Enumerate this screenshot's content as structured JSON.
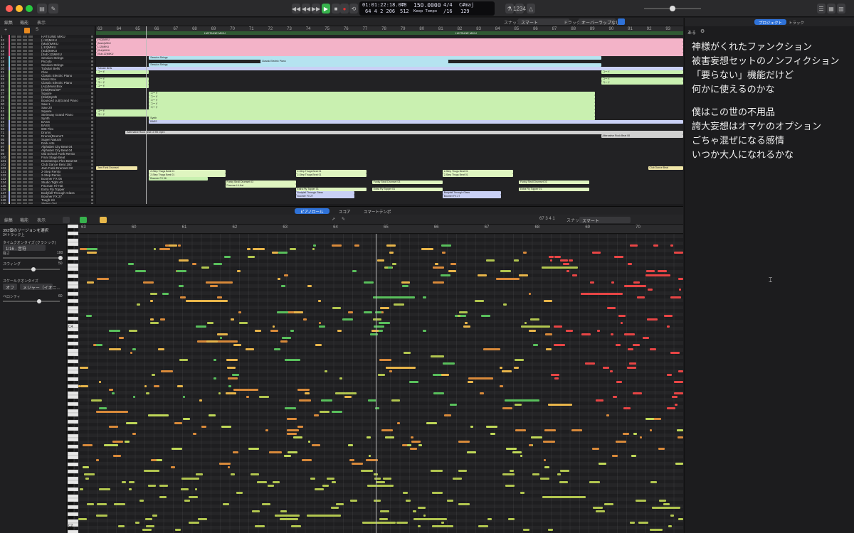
{
  "transport": {
    "position_time": "01:01:22:18.07",
    "position_bars": "64  4  2  206",
    "bars_value": "48",
    "bars_sub": "512",
    "tempo": "150.0000",
    "tempo_mode": "Keep Tempo",
    "signature": "4/4",
    "division": "/16",
    "key": "C#maj",
    "cpu": "129"
  },
  "arrange_toolbar": {
    "edit": "編集",
    "functions": "機能",
    "view": "表示",
    "snap_label": "スナップ:",
    "snap_value": "スマート",
    "drag_label": "ドラッグ:",
    "drag_value": "オーバーラップなし"
  },
  "side_panel": {
    "tab_project": "プロジェクト",
    "tab_track": "トラック",
    "sub_header": "ある"
  },
  "marker_labels": [
    "HATSUNE MIKU",
    "HATSUNE MIKU"
  ],
  "tracks": [
    {
      "num": "1",
      "name": "HATSUNE MIKU",
      "color": "#e75a8a"
    },
    {
      "num": "12",
      "name": "(+12)MIKU",
      "color": "#e75a8a"
    },
    {
      "num": "13",
      "name": "(Main)MIKU",
      "color": "#e75a8a"
    },
    {
      "num": "14",
      "name": "(-12)MIKU",
      "color": "#e75a8a"
    },
    {
      "num": "15",
      "name": "(Sub)MIKU",
      "color": "#e75a8a"
    },
    {
      "num": "16",
      "name": "(Sub-12)MIKU",
      "color": "#e75a8a"
    },
    {
      "num": "17",
      "name": "Session Strings",
      "color": "#7fd0e8"
    },
    {
      "num": "18",
      "name": "Piccolo",
      "color": "#7fd0e8"
    },
    {
      "num": "19",
      "name": "Session Strings",
      "color": "#7fd0e8"
    },
    {
      "num": "20",
      "name": "Tubular Bells",
      "color": "#a9b6f0"
    },
    {
      "num": "21",
      "name": "Clav",
      "color": "#9fd87f"
    },
    {
      "num": "22",
      "name": "Classic Electric Piano",
      "color": "#9fd87f"
    },
    {
      "num": "23",
      "name": "Music Box",
      "color": "#9fd87f"
    },
    {
      "num": "24",
      "name": "Classic Electric Piano",
      "color": "#9fd87f"
    },
    {
      "num": "25",
      "name": "(Arp)MusicBox",
      "color": "#9fd87f"
    },
    {
      "num": "26",
      "name": "(Dist)Real EP",
      "color": "#9fd87f"
    },
    {
      "num": "27",
      "name": "Square",
      "color": "#9fd87f"
    },
    {
      "num": "28",
      "name": "(Dist)Synth",
      "color": "#9fd87f"
    },
    {
      "num": "29",
      "name": "Bounced cut(Grand Piano",
      "color": "#9fd87f"
    },
    {
      "num": "30",
      "name": "Saw 1",
      "color": "#9fd87f"
    },
    {
      "num": "41",
      "name": "Saw 20",
      "color": "#9fd87f"
    },
    {
      "num": "42",
      "name": "Square",
      "color": "#9fd87f"
    },
    {
      "num": "45",
      "name": "Steinway Grand Piano",
      "color": "#9fd87f"
    },
    {
      "num": "46",
      "name": "Synth",
      "color": "#9fd87f"
    },
    {
      "num": "49",
      "name": "BASS",
      "color": "#a9b6f0"
    },
    {
      "num": "52",
      "name": "BASS",
      "color": "#a9b6f0"
    },
    {
      "num": "53",
      "name": "808 Flex",
      "color": "#a9b6f0"
    },
    {
      "num": "71",
      "name": "Drums",
      "color": "#c9c9c9"
    },
    {
      "num": "72",
      "name": "Drums(DrumsT.",
      "color": "#c9c9c9"
    },
    {
      "num": "95",
      "name": "Super Natural",
      "color": "#c9c9c9"
    },
    {
      "num": "96",
      "name": "Dark Arts",
      "color": "#c9c9c9"
    },
    {
      "num": "97",
      "name": "Alphabet City Beat 04",
      "color": "#e9d98f"
    },
    {
      "num": "98",
      "name": "Alphabet City Beat 04",
      "color": "#e9d98f"
    },
    {
      "num": "99",
      "name": "Old School Funk Remix",
      "color": "#e9d98f"
    },
    {
      "num": "100",
      "name": "Final Stage Beat",
      "color": "#e9d98f"
    },
    {
      "num": "101",
      "name": "Downtempo Flex Beat 02",
      "color": "#e9d98f"
    },
    {
      "num": "102",
      "name": "Club Dance Beat 192",
      "color": "#e9d98f"
    },
    {
      "num": "103",
      "name": "Jam Funk Drumset 02",
      "color": "#e9d98f"
    },
    {
      "num": "121",
      "name": "2-Step Remix",
      "color": "#c9f0a0"
    },
    {
      "num": "122",
      "name": "2-Step Remix",
      "color": "#c9f0a0"
    },
    {
      "num": "123",
      "name": "Boomer FX 06",
      "color": "#c9f0a0"
    },
    {
      "num": "124",
      "name": "Studio Tight 40",
      "color": "#c9f0a0"
    },
    {
      "num": "125",
      "name": "Pacman Hi-Hat",
      "color": "#c9f0a0"
    },
    {
      "num": "126",
      "name": "Extra Fly Topper",
      "color": "#c9f0a0"
    },
    {
      "num": "127",
      "name": "Bodyfall Through Glass",
      "color": "#a9b6f0"
    },
    {
      "num": "128",
      "name": "Boomer FX 27",
      "color": "#a9b6f0"
    },
    {
      "num": "129",
      "name": "Tough Kit",
      "color": "#a9b6f0"
    },
    {
      "num": "130",
      "name": "Stereo Out",
      "color": "#c9c9c9"
    }
  ],
  "arrange_bars": [
    "63",
    "64",
    "65",
    "66",
    "67",
    "68",
    "69",
    "70",
    "71",
    "72",
    "73",
    "74",
    "75",
    "76",
    "77",
    "78",
    "79",
    "80",
    "81",
    "82",
    "83",
    "84",
    "85",
    "86",
    "87",
    "88",
    "89",
    "90",
    "91",
    "92",
    "93"
  ],
  "regions": [
    {
      "row": 1,
      "start": 0.0,
      "end": 1.0,
      "color": "#f3b3c8",
      "label": "(+12)MIKU"
    },
    {
      "row": 2,
      "start": 0.0,
      "end": 1.0,
      "color": "#f3b3c8",
      "label": "(Main)MIKU"
    },
    {
      "row": 3,
      "start": 0.0,
      "end": 1.0,
      "color": "#f3b3c8",
      "label": "(-12)MIKU"
    },
    {
      "row": 4,
      "start": 0.0,
      "end": 1.0,
      "color": "#f3b3c8",
      "label": "(Sub)MIKU"
    },
    {
      "row": 5,
      "start": 0.0,
      "end": 1.0,
      "color": "#f3b3c8",
      "label": "(Sub-12)MIKU"
    },
    {
      "row": 6,
      "start": 0.09,
      "end": 0.86,
      "color": "#b5e3f0",
      "label": "Session Strings"
    },
    {
      "row": 7,
      "start": 0.28,
      "end": 0.6,
      "color": "#b5e3f0",
      "label": "Classic Electric Piano"
    },
    {
      "row": 8,
      "start": 0.09,
      "end": 0.86,
      "color": "#b5e3f0",
      "label": "Session Strings"
    },
    {
      "row": 9,
      "start": 0.0,
      "end": 1.0,
      "color": "#c9d0f5",
      "label": "Tubular Bells"
    },
    {
      "row": 10,
      "start": 0.0,
      "end": 0.09,
      "color": "#c9f0b0",
      "label": "コード"
    },
    {
      "row": 10,
      "start": 0.86,
      "end": 1.0,
      "color": "#c9f0b0",
      "label": "コード"
    },
    {
      "row": 12,
      "start": 0.0,
      "end": 0.09,
      "color": "#c9f0b0",
      "label": "コード"
    },
    {
      "row": 12,
      "start": 0.86,
      "end": 1.0,
      "color": "#c9f0b0",
      "label": "コード"
    },
    {
      "row": 13,
      "start": 0.0,
      "end": 0.09,
      "color": "#c9f0b0",
      "label": "コード"
    },
    {
      "row": 13,
      "start": 0.86,
      "end": 1.0,
      "color": "#c9f0b0",
      "label": "コード"
    },
    {
      "row": 14,
      "start": 0.0,
      "end": 0.09,
      "color": "#c9f0b0",
      "label": "コード"
    },
    {
      "row": 16,
      "start": 0.09,
      "end": 0.85,
      "color": "#c9f0b0",
      "label": "コード"
    },
    {
      "row": 17,
      "start": 0.09,
      "end": 0.85,
      "color": "#c9f0b0",
      "label": "コード"
    },
    {
      "row": 18,
      "start": 0.09,
      "end": 0.85,
      "color": "#c9f0b0",
      "label": "コード"
    },
    {
      "row": 19,
      "start": 0.09,
      "end": 0.85,
      "color": "#c9f0b0",
      "label": "コード"
    },
    {
      "row": 20,
      "start": 0.09,
      "end": 0.85,
      "color": "#c9f0b0",
      "label": "コード"
    },
    {
      "row": 21,
      "start": 0.0,
      "end": 0.85,
      "color": "#c9f0b0",
      "label": "コード"
    },
    {
      "row": 22,
      "start": 0.0,
      "end": 0.85,
      "color": "#c9f0b0",
      "label": "コード"
    },
    {
      "row": 23,
      "start": 0.09,
      "end": 0.85,
      "color": "#c9f0b0",
      "label": "Synth"
    },
    {
      "row": 24,
      "start": 0.09,
      "end": 1.0,
      "color": "#c9d0f5",
      "label": "BASS"
    },
    {
      "row": 27,
      "start": 0.05,
      "end": 1.0,
      "color": "#d0d0d0",
      "label": "Alternative Rock Beat 10 Hit Open"
    },
    {
      "row": 28,
      "start": 0.86,
      "end": 1.0,
      "color": "#d0d0d0",
      "label": "Alternative Rock Beat 08"
    },
    {
      "row": 37,
      "start": 0.0,
      "end": 0.07,
      "color": "#f0e6a8",
      "label": "Jam Funk Drumset"
    },
    {
      "row": 37,
      "start": 0.94,
      "end": 1.0,
      "color": "#f0e6a8",
      "label": "Club Dance Beat"
    },
    {
      "row": 38,
      "start": 0.09,
      "end": 0.22,
      "color": "#dff5c0",
      "label": "2-Step Thugs Beat 01"
    },
    {
      "row": 38,
      "start": 0.34,
      "end": 0.46,
      "color": "#dff5c0",
      "label": "2-Step Thugs Beat 01"
    },
    {
      "row": 38,
      "start": 0.59,
      "end": 0.71,
      "color": "#dff5c0",
      "label": "2-Step Thugs Beat 01"
    },
    {
      "row": 39,
      "start": 0.09,
      "end": 0.22,
      "color": "#dff5c0",
      "label": "2-Step Thugs Beat 01"
    },
    {
      "row": 39,
      "start": 0.34,
      "end": 0.46,
      "color": "#dff5c0",
      "label": "2-Step Thugs Beat 01"
    },
    {
      "row": 39,
      "start": 0.59,
      "end": 0.71,
      "color": "#dff5c0",
      "label": "2-Step Thugs Beat 01"
    },
    {
      "row": 40,
      "start": 0.09,
      "end": 0.19,
      "color": "#c9f0b0",
      "label": "Boomer FX 06"
    },
    {
      "row": 41,
      "start": 0.22,
      "end": 0.34,
      "color": "#dff5c0",
      "label": "Funky Stroll Drumset 03"
    },
    {
      "row": 41,
      "start": 0.47,
      "end": 0.59,
      "color": "#dff5c0",
      "label": "Funky Stroll Drumset 03"
    },
    {
      "row": 41,
      "start": 0.72,
      "end": 0.84,
      "color": "#dff5c0",
      "label": "Funky Stroll Drumset 03"
    },
    {
      "row": 42,
      "start": 0.22,
      "end": 0.34,
      "color": "#dff5c0",
      "label": "Pacman Hi-Hat"
    },
    {
      "row": 43,
      "start": 0.34,
      "end": 0.46,
      "color": "#dff5c0",
      "label": "Extra Fly Topper 01"
    },
    {
      "row": 43,
      "start": 0.47,
      "end": 0.59,
      "color": "#dff5c0",
      "label": "Extra Fly Topper 01"
    },
    {
      "row": 43,
      "start": 0.72,
      "end": 0.84,
      "color": "#dff5c0",
      "label": "Extra Fly Topper 01"
    },
    {
      "row": 44,
      "start": 0.34,
      "end": 0.44,
      "color": "#c9d0f5",
      "label": "Bodyfall Through Glass"
    },
    {
      "row": 44,
      "start": 0.59,
      "end": 0.69,
      "color": "#c9d0f5",
      "label": "Bodyfall Through Glass"
    },
    {
      "row": 45,
      "start": 0.34,
      "end": 0.44,
      "color": "#c9d0f5",
      "label": "Boomer FX 27"
    },
    {
      "row": 45,
      "start": 0.59,
      "end": 0.69,
      "color": "#c9d0f5",
      "label": "Boomer FX 27"
    }
  ],
  "lyrics": {
    "stanza1": [
      "神様がくれたファンクション",
      "被害妄想セットのノンフィクション",
      "「要らない」機能だけど",
      "何かに使えるのかな"
    ],
    "stanza2": [
      "僕はこの世の不用品",
      "誇大妄想はオマケのオプション",
      "ごちゃ混ぜになる感情",
      "いつか大人になれるかな"
    ]
  },
  "piano_roll": {
    "tab_piano_roll": "ピアノロール",
    "tab_score": "スコア",
    "tab_smart_tempo": "スマートテンポ",
    "edit": "編集",
    "functions": "機能",
    "view": "表示",
    "position": "67 3 4 1",
    "snap_label": "スナップ:",
    "snap_value": "スマート",
    "selection_title": "393個のリージョンを選択",
    "selection_sub": "34トラック上",
    "quantize_label": "タイムクオンタイズ (クラシック)",
    "quantize_value": "1/16 - 音符",
    "strength_label": "強さ",
    "strength_value": "100",
    "swing_label": "スウィング",
    "swing_value": "50",
    "scale_label": "スケールクオンタイズ",
    "scale_off": "オフ",
    "scale_value": "メジャー（イオニ...",
    "velocity_label": "ベロシティ",
    "velocity_value": "60",
    "bars": [
      "63",
      "60",
      "61",
      "62",
      "63",
      "64",
      "65",
      "66",
      "67",
      "68",
      "69",
      "70"
    ],
    "octave_labels": [
      "C4",
      "C3",
      "C2"
    ]
  },
  "note_colors": [
    "#59c05c",
    "#e8b54a",
    "#d98a3a",
    "#b2c64f",
    "#e84545",
    "#3db6c9",
    "#6a5fd9",
    "#c0d858"
  ]
}
